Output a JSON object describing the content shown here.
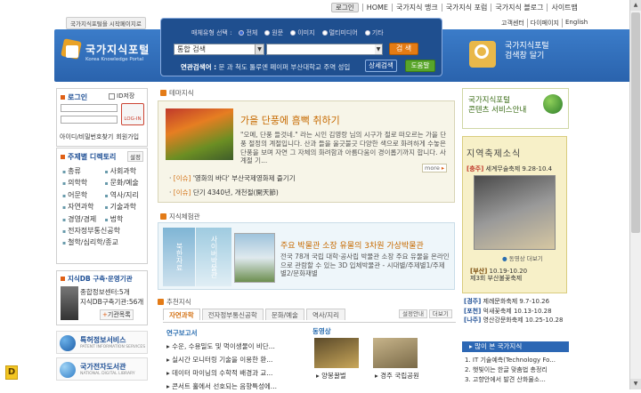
{
  "header": {
    "login_label": "로그인",
    "top_links": [
      "HOME",
      "국가지식 맹크",
      "국가지식 포럼",
      "국가지식 블로그",
      "사이트맵"
    ],
    "lang_links": [
      "고객센터",
      "다이페이지",
      "English"
    ],
    "homepage_link": "국가지식포털을 시작페이지로"
  },
  "logo": {
    "title": "국가지식포털",
    "subtitle": "Korea Knowledge Portal"
  },
  "search": {
    "type_label": "매체유형 선택 :",
    "types": [
      "전체",
      "원문",
      "이미지",
      "멀티미디어",
      "기타"
    ],
    "selected_type": "전체",
    "scope_value": "통합 검색",
    "query_value": "",
    "search_button": "검 색",
    "related_label": "연관검색어 :",
    "related_text": "문 과 척도 툴루엔 페이퍼 부산대학교 주역 성입",
    "advanced_button": "상세검색",
    "help_button": "도움말"
  },
  "banner_right": {
    "line1": "국가지식포털",
    "line2": "검색창 달기"
  },
  "login_box": {
    "title": "로그인",
    "save_id": "ID저장",
    "find_link": "아이디/비밀번호찾기",
    "join_link": "회원가입",
    "login_button": "LOG-IN"
  },
  "subjects": {
    "title": "주제별 디렉토리",
    "settings": "설정",
    "items": [
      "총류",
      "사회과학",
      "의학학",
      "문화/예술",
      "어문학",
      "역사/지리",
      "자연과학",
      "기술과학",
      "경영/경제",
      "법학",
      "전자정부통신공학",
      "철학/심리학/종교"
    ]
  },
  "db_box": {
    "title": "지식DB 구축·운영기관",
    "line1": "종합정보센터:5개",
    "line2": "지식DB구축기관:56개",
    "more": "기관목록"
  },
  "orgs": {
    "item1": "특허정보서비스",
    "item1_sub": "PATENT INFORMATION SERVICES",
    "item2": "국가전자도서관",
    "item2_sub": "NATIONAL DIGITAL LIBRARY"
  },
  "theme": {
    "section": "테마지식",
    "title": "가을 단풍에 흠뻑 취하기",
    "desc": "\"오메, 단풍 들것네.\" 라는 시인 김영랑 님의 시구가 절로 떠오르는 가을 단풍 절정의 계절입니다. 산과 들을 울긋불긋 다양한 색으로 화려하게 수놓은 단풍을 보며 자연 그 자체의 화려함과 아름다움이 경이롭기까지 합니다. 사계절 기...",
    "more": "more",
    "link1_tag": "[이슈]",
    "link1": "'영화의 바다' 부산국제영화제 즐기기",
    "link2_tag": "[이슈]",
    "link2": "단기 4340년, 개천절(開天節)"
  },
  "experience": {
    "section": "지식체험관",
    "img1_text": "북한자료",
    "img2_text": "사이버박물관",
    "title": "주요 박물관 소장 유물의 3차원 가상박물관",
    "desc": "전국 78개 국립 대학·공사립 박물관 소장 주요 유물을 온라인으로 관람할 수 있는 3D 입체박물관 - 시대별/주제별1/주제별2/문화재별"
  },
  "recommend": {
    "section": "추천지식",
    "tabs": [
      "자연과학",
      "전자정부통신공학",
      "문화/예술",
      "역사/지리"
    ],
    "active_tab": "자연과학",
    "btn_settings": "설정안내",
    "btn_more": "더보기",
    "reports_header": "연구보고서",
    "reports": [
      "수운, 수용밀도 및 먹이생물이 비단...",
      "실시간 모니터링 기술을 이용한 환...",
      "데이터 마이닝의 수학적 배경과 교...",
      "콘서트 홀에서 선호되는 음향특성에..."
    ],
    "video_header": "동영상",
    "video1": "양봉꿀벌",
    "video2": "경주 국립공원"
  },
  "right_service": {
    "line1": "국가지식포털",
    "line2": "콘텐츠 서비스안내"
  },
  "festival": {
    "title": "지역축제소식",
    "f1_tag": "[충주]",
    "f1": "세계무술축제 9.28-10.4",
    "map_btn": "동영상 더보기",
    "f2_tag": "[부산]",
    "f2": "제3회 부산불꽃축제",
    "f2_date": "10.19-10.20",
    "list": [
      {
        "tag": "[경주]",
        "text": "제례문화축제 9.7-10.26"
      },
      {
        "tag": "[포천]",
        "text": "억새꽃축제 10.13-10.28"
      },
      {
        "tag": "[나주]",
        "text": "영산강문화축제 10.25-10.28"
      }
    ]
  },
  "lots": {
    "title": "많이 본 국가지식",
    "items": [
      "1. IT 기술예측(Technology Fo...",
      "2. 햇빛이는 한글 맞춤법 총정리",
      "3. 고향안에서 발견 산화물소..."
    ]
  }
}
